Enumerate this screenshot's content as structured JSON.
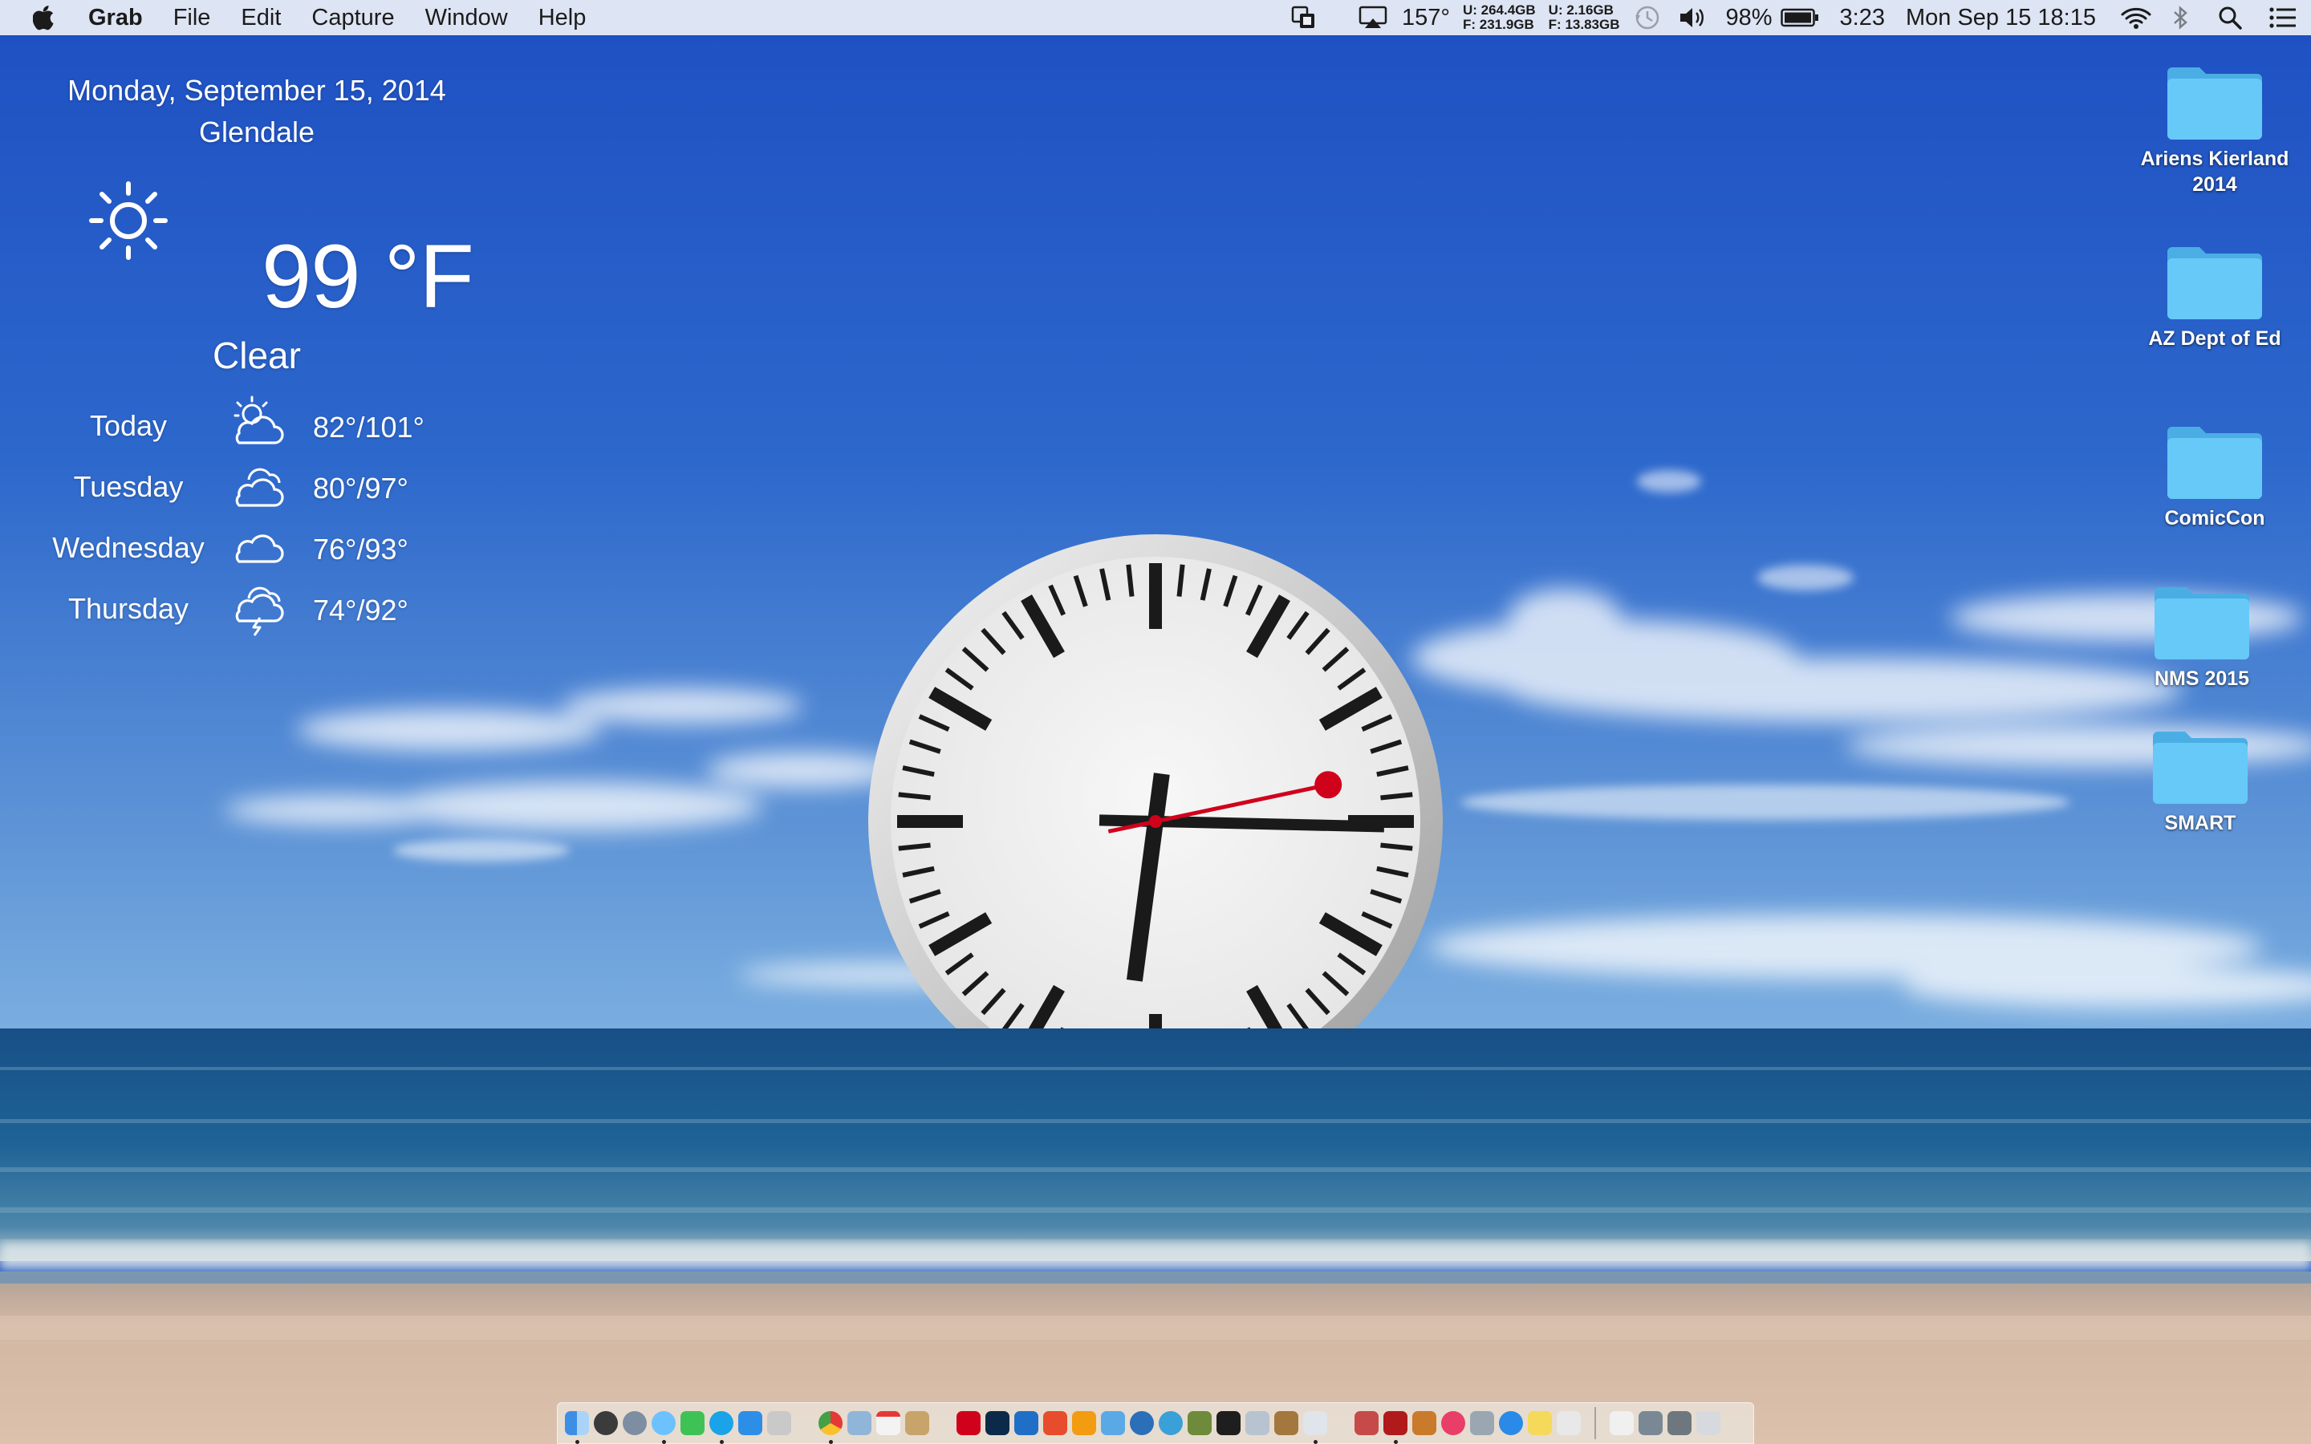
{
  "menubar": {
    "apple_icon": "apple-logo-icon",
    "app_name": "Grab",
    "menus": [
      "File",
      "Edit",
      "Capture",
      "Window",
      "Help"
    ],
    "status": {
      "cpu_temp": "157°",
      "disk1_used": "U: 264.4GB",
      "disk1_free": "F: 231.9GB",
      "disk2_used": "U:  2.16GB",
      "disk2_free": "F: 13.83GB",
      "battery_percent": "98%",
      "battery_time": "3:23",
      "clock": "Mon Sep 15  18:15"
    }
  },
  "weather": {
    "date": "Monday, September 15, 2014",
    "city": "Glendale",
    "temperature": "99 °F",
    "condition": "Clear",
    "current_icon": "sun-icon",
    "forecast": [
      {
        "day": "Today",
        "range": "82°/101°",
        "icon": "partly-cloudy-icon"
      },
      {
        "day": "Tuesday",
        "range": "80°/97°",
        "icon": "cloudy-icon"
      },
      {
        "day": "Wednesday",
        "range": "76°/93°",
        "icon": "cloud-icon"
      },
      {
        "day": "Thursday",
        "range": "74°/92°",
        "icon": "thunderstorm-icon"
      }
    ]
  },
  "clock": {
    "hours": 6,
    "minutes": 15,
    "seconds": 13
  },
  "desktop_icons": [
    {
      "label_line1": "Ariens Kierland",
      "label_line2": "2014"
    },
    {
      "label_line1": "AZ Dept of Ed",
      "label_line2": ""
    },
    {
      "label_line1": "ComicCon",
      "label_line2": ""
    },
    {
      "label_line1": "NMS 2015",
      "label_line2": ""
    },
    {
      "label_line1": "SMART",
      "label_line2": ""
    }
  ],
  "colors": {
    "sky_top": "#1f52c4",
    "sky_bottom": "#6b9fd8",
    "sea": "#1d5a8a",
    "sand": "#d4b9a6",
    "folder": "#5cc3f5",
    "second_hand": "#d0021b"
  }
}
